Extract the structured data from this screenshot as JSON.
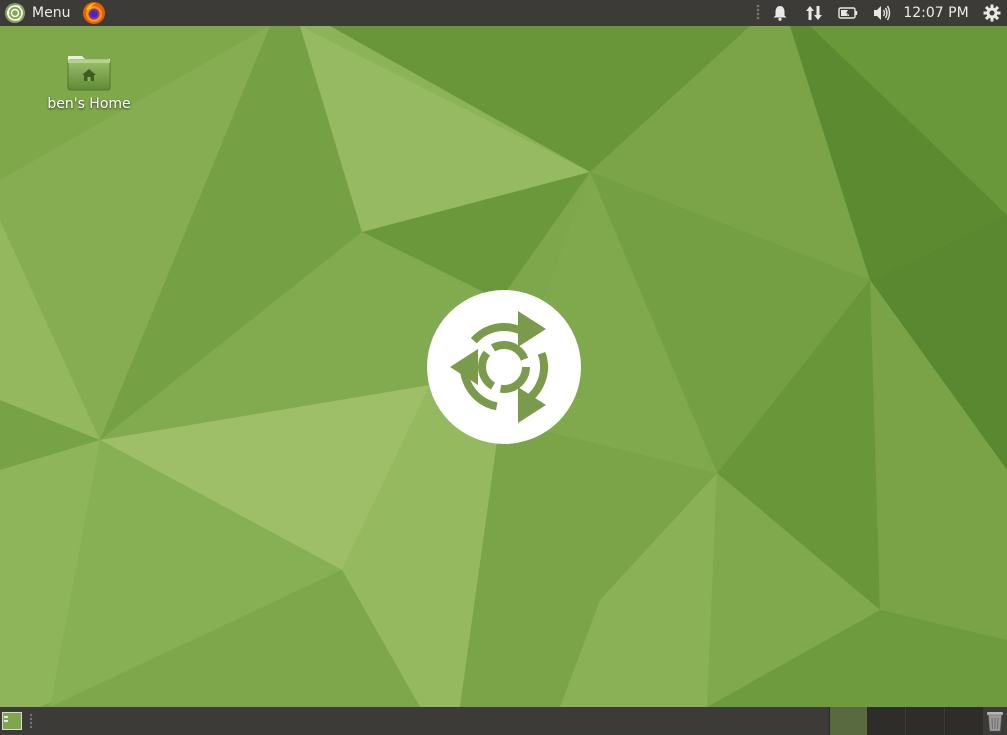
{
  "top_panel": {
    "menu_label": "Menu",
    "launchers": [
      {
        "name": "firefox",
        "icon": "firefox-icon"
      }
    ],
    "tray": {
      "icons": [
        "notification-bell-icon",
        "network-transfer-icon",
        "battery-icon",
        "volume-icon",
        "session-gear-icon"
      ],
      "clock": "12:07 PM"
    }
  },
  "desktop": {
    "icons": [
      {
        "label": "ben's Home",
        "icon": "home-folder-icon"
      }
    ],
    "center_logo": "ubuntu-mate-logo-icon"
  },
  "bottom_panel": {
    "workspaces": [
      {
        "index": 1,
        "active": true
      },
      {
        "index": 2,
        "active": false
      },
      {
        "index": 3,
        "active": false
      },
      {
        "index": 4,
        "active": false
      }
    ],
    "icons": [
      "show-desktop-icon",
      "trash-icon"
    ]
  },
  "colors": {
    "panel": "#3c3b37",
    "wallpaper_base": "#7ea64a",
    "active_workspace": "#5a6a40",
    "accent": "#87a556"
  }
}
